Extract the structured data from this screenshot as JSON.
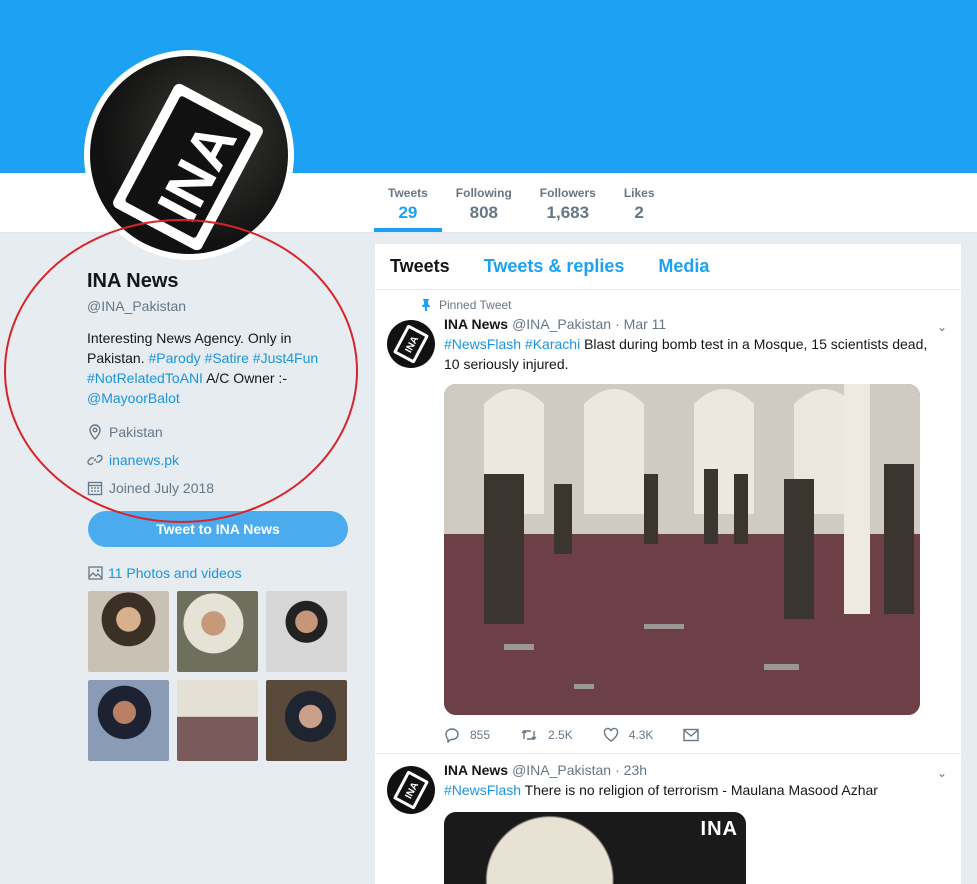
{
  "profile": {
    "name": "INA News",
    "handle": "@INA_Pakistan",
    "bio_prefix": "Interesting News Agency. Only in Pakistan.",
    "bio_tags": [
      "#Parody",
      "#Satire",
      "#Just4Fun",
      "#NotRelatedToANI"
    ],
    "bio_owner": "A/C Owner :-",
    "bio_owner_handle": "@MayoorBalot",
    "location": "Pakistan",
    "website": "inanews.pk",
    "joined": "Joined July 2018",
    "tweet_to_label": "Tweet to INA News",
    "photos_label": "11 Photos and videos",
    "avatar_logo": "INA"
  },
  "stats": [
    {
      "label": "Tweets",
      "value": "29"
    },
    {
      "label": "Following",
      "value": "808"
    },
    {
      "label": "Followers",
      "value": "1,683"
    },
    {
      "label": "Likes",
      "value": "2"
    }
  ],
  "tabs": [
    "Tweets",
    "Tweets & replies",
    "Media"
  ],
  "tweets": [
    {
      "pinned": "Pinned Tweet",
      "name": "INA News",
      "handle": "@INA_Pakistan",
      "time": "· Mar 11",
      "tags": [
        "#NewsFlash",
        "#Karachi"
      ],
      "text": "Blast during bomb test in a Mosque, 15 scientists dead, 10 seriously injured.",
      "replies": "855",
      "retweets": "2.5K",
      "likes": "4.3K"
    },
    {
      "name": "INA News",
      "handle": "@INA_Pakistan",
      "time": "· 23h",
      "tags": [
        "#NewsFlash"
      ],
      "text": "There is no religion of terrorism - Maulana Masood Azhar",
      "watermark": "INA"
    }
  ],
  "colors": {
    "accent": "#1da1f2",
    "link": "#1b95e0",
    "annotation": "#d8232a"
  }
}
